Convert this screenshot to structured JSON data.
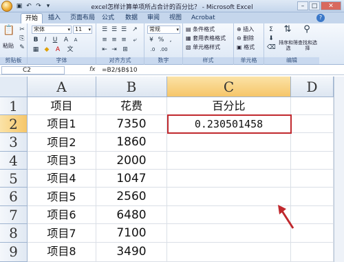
{
  "window": {
    "title": "excel怎样计算单项所占合计的百分比？ - Microsoft Excel",
    "controls": {
      "minimize": "–",
      "maximize": "□",
      "close": "✕"
    }
  },
  "quick_access": {
    "save_icon": "save-icon",
    "undo_icon": "undo-icon",
    "redo_icon": "redo-icon"
  },
  "ribbon_tabs": [
    "开始",
    "插入",
    "页面布局",
    "公式",
    "数据",
    "审阅",
    "视图",
    "Acrobat"
  ],
  "active_tab": "开始",
  "ribbon": {
    "clipboard": {
      "paste": "粘贴",
      "label": "剪贴板"
    },
    "font": {
      "name": "宋体",
      "size": "11",
      "bold": "B",
      "italic": "I",
      "underline": "U",
      "label": "字体"
    },
    "alignment": {
      "label": "对齐方式"
    },
    "number": {
      "format": "常规",
      "percent": "%",
      "comma": ",",
      "label": "数字"
    },
    "styles": {
      "conditional": "条件格式",
      "table": "套用表格格式",
      "cell": "单元格样式",
      "label": "样式"
    },
    "cells": {
      "insert": "插入",
      "delete": "删除",
      "format": "格式",
      "label": "单元格"
    },
    "editing": {
      "sum": "Σ",
      "sort": "排序和筛选",
      "find": "查找和选择",
      "label": "编辑"
    }
  },
  "formula_bar": {
    "name_box": "C2",
    "fx": "fx",
    "formula": "=B2/$B$10"
  },
  "columns": [
    "A",
    "B",
    "C",
    "D"
  ],
  "rows": [
    {
      "num": "1",
      "a": "项目",
      "b": "花费",
      "c": "百分比"
    },
    {
      "num": "2",
      "a": "项目1",
      "b": "7350",
      "c": "0.230501458"
    },
    {
      "num": "3",
      "a": "项目2",
      "b": "1860",
      "c": ""
    },
    {
      "num": "4",
      "a": "项目3",
      "b": "2000",
      "c": ""
    },
    {
      "num": "5",
      "a": "项目4",
      "b": "1047",
      "c": ""
    },
    {
      "num": "6",
      "a": "项目5",
      "b": "2560",
      "c": ""
    },
    {
      "num": "7",
      "a": "项目6",
      "b": "6480",
      "c": ""
    },
    {
      "num": "8",
      "a": "项目7",
      "b": "7100",
      "c": ""
    },
    {
      "num": "9",
      "a": "项目8",
      "b": "3490",
      "c": ""
    }
  ],
  "selected_cell": "C2",
  "colors": {
    "selection_border": "#c0282d",
    "header_selected": "#f6c669"
  }
}
